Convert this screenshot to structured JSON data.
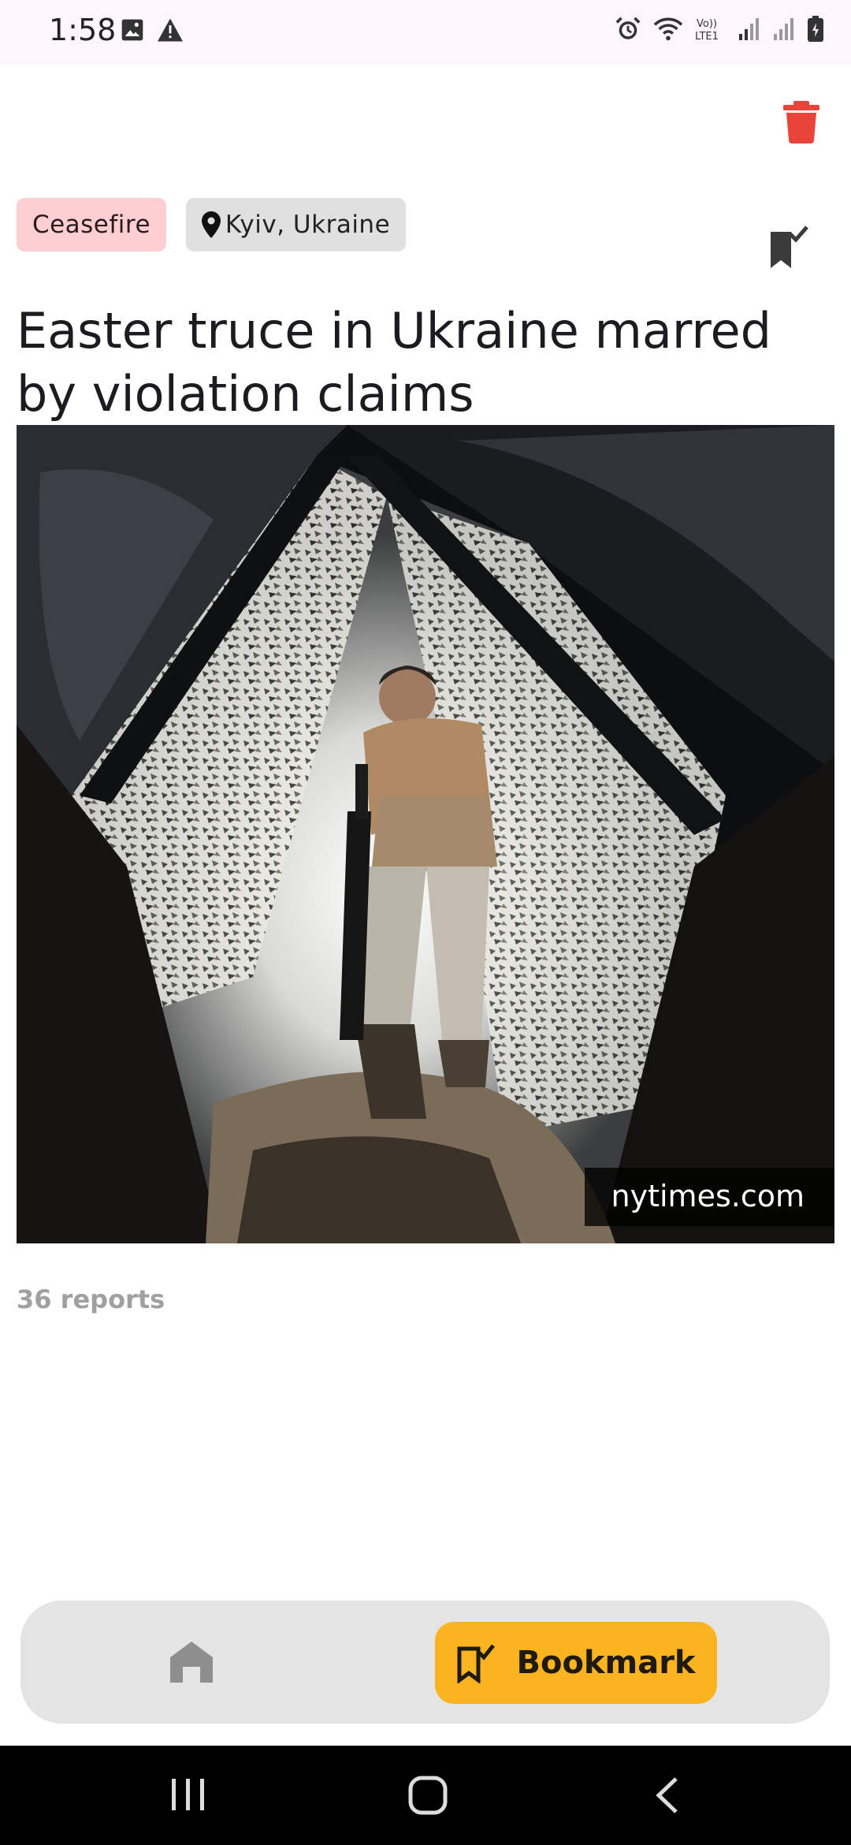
{
  "status_bar": {
    "time": "1:58",
    "left_icons": [
      "image-icon",
      "warning-icon"
    ],
    "right_icons": [
      "alarm-icon",
      "wifi-icon",
      "volte-icon",
      "signal-icon",
      "signal-icon",
      "battery-icon"
    ],
    "volte_label": "Vo))\nLTE1"
  },
  "article": {
    "topic": "Ceasefire",
    "location": "Kyiv, Ukraine",
    "headline": "Easter truce in Ukraine marred by violation claims",
    "source": "nytimes.com",
    "reports": "36 reports",
    "image_alt": "Soldier entering a camouflaged trench"
  },
  "bottom_nav": {
    "home_icon": "home-icon",
    "bookmark_label": "Bookmark"
  },
  "colors": {
    "accent": "#fbb41f",
    "delete": "#e8443a",
    "topic_chip": "#fdcfd3",
    "location_chip": "#e0e0e0"
  }
}
